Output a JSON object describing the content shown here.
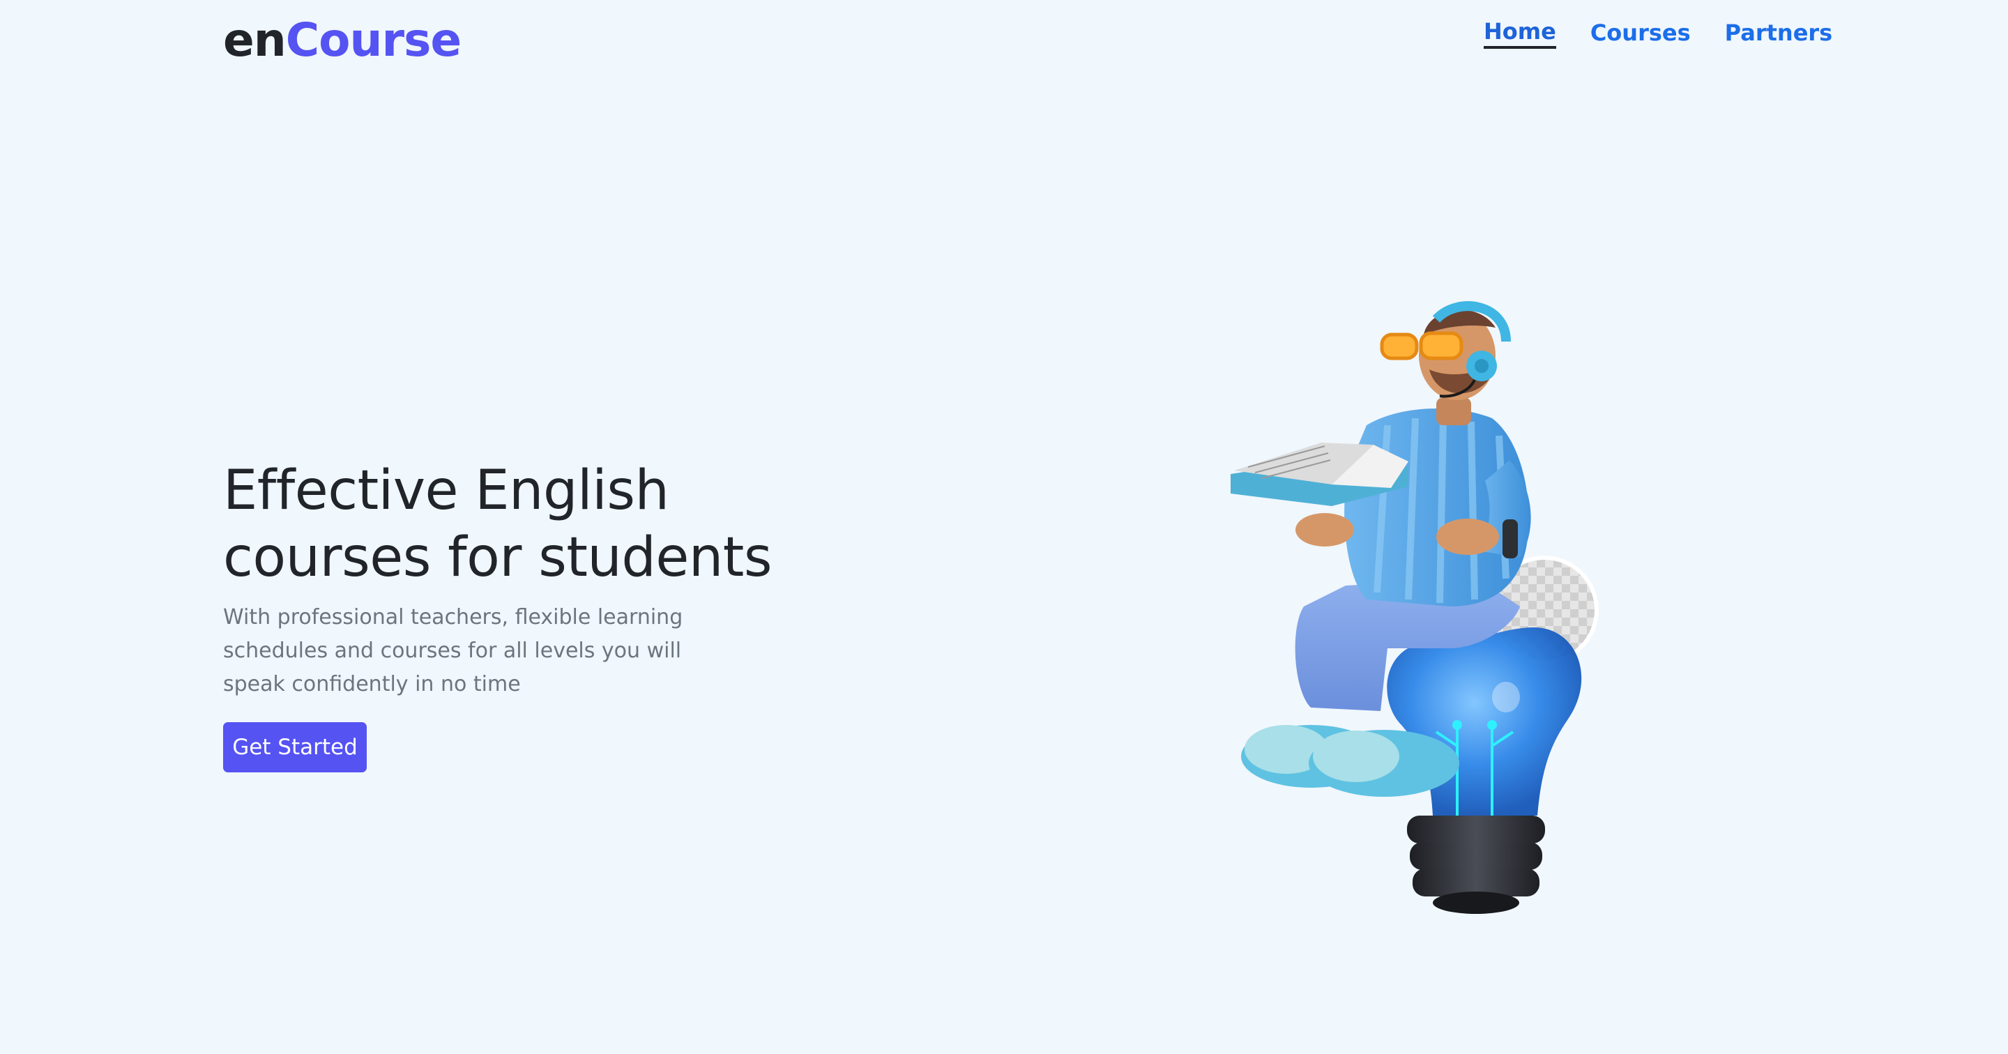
{
  "brand": {
    "prefix": "en",
    "accent": "Course",
    "accent_color": "#5553f2"
  },
  "nav": {
    "items": [
      {
        "label": "Home",
        "active": true
      },
      {
        "label": "Courses",
        "active": false
      },
      {
        "label": "Partners",
        "active": false
      }
    ],
    "link_color": "#1c6ee9"
  },
  "hero": {
    "title_line1": "Effective English",
    "title_line2": "courses for students",
    "description_line1": "With professional teachers, flexible learning",
    "description_line2": "schedules and courses for all levels you will",
    "description_line3": "speak confidently in no time",
    "cta_label": "Get Started",
    "cta_color": "#5553f2",
    "illustration": "student-on-lightbulb-illustration"
  },
  "colors": {
    "background": "#f0f7fd",
    "text": "#212529",
    "muted": "#6c757d"
  }
}
